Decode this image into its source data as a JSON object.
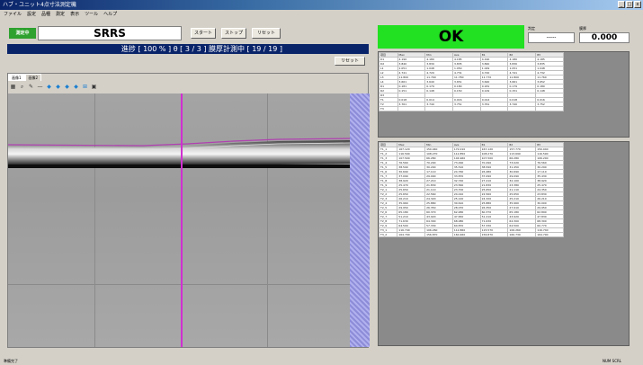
{
  "window": {
    "title": "ハブ・ユニット4点寸法測定機",
    "min": "_",
    "max": "□",
    "close": "x"
  },
  "menu": [
    "ファイル",
    "設定",
    "品種",
    "測定",
    "表示",
    "ツール",
    "ヘルプ"
  ],
  "header": {
    "mode_label": "測定中",
    "product": "SRRS",
    "buttons": [
      "スタート",
      "ストップ",
      "リセット"
    ],
    "status": "進捗 [ 100 % ] θ [ 3 / 3 ] 膜厚計測中 [ 19 / 19 ]",
    "reset_label": "リセット"
  },
  "image_panel": {
    "tabs": [
      "画像1",
      "画像2"
    ]
  },
  "result": {
    "judgement": "OK",
    "left_label": "判定",
    "left_value": "-----",
    "right_label": "膜厚",
    "right_value": "0.000"
  },
  "table1": {
    "headers": [
      "項目",
      "Max",
      "Min",
      "Ave",
      "θ1",
      "θ2",
      "θ3"
    ],
    "rows": [
      [
        "D1",
        "4.190",
        "4.180",
        "4.185",
        "4.190",
        "4.180",
        "4.185"
      ],
      [
        "D2",
        "3.840",
        "3.830",
        "3.835",
        "3.840",
        "3.830",
        "3.835"
      ],
      [
        "L1",
        "1.051",
        "1.048",
        "1.050",
        "1.049",
        "1.051",
        "1.048"
      ],
      [
        "L2",
        "4.741",
        "4.720",
        "4.731",
        "4.720",
        "4.741",
        "4.732"
      ],
      [
        "L3",
        "11.800",
        "11.760",
        "11.780",
        "11.770",
        "11.800",
        "11.760"
      ],
      [
        "L4",
        "3.661",
        "3.640",
        "3.651",
        "3.640",
        "3.661",
        "3.652"
      ],
      [
        "R1",
        "0.181",
        "0.179",
        "0.180",
        "0.181",
        "0.179",
        "0.180"
      ],
      [
        "R2",
        "0.151",
        "0.148",
        "0.150",
        "0.149",
        "0.151",
        "0.148"
      ],
      [
        "R3",
        "",
        "",
        "",
        "",
        "",
        ""
      ],
      [
        "T1",
        "0.018",
        "0.014",
        "0.016",
        "0.014",
        "0.018",
        "0.016"
      ],
      [
        "T2",
        "3.761",
        "3.740",
        "3.751",
        "3.761",
        "3.740",
        "3.752"
      ],
      [
        "T3",
        "",
        "",
        "",
        "",
        "",
        ""
      ]
    ]
  },
  "table2": {
    "headers": [
      "項目",
      "Max",
      "Min",
      "Ave",
      "θ1",
      "θ2",
      "θ3"
    ],
    "rows": [
      [
        "T1_1",
        "167.120",
        "150.040",
        "172.010",
        "167.120",
        "157.770",
        "150.040"
      ],
      [
        "T1_2",
        "116.590",
        "108.270",
        "112.850",
        "108.270",
        "113.690",
        "116.590"
      ],
      [
        "T1_3",
        "107.500",
        "66.280",
        "104.960",
        "107.500",
        "66.280",
        "106.200"
      ],
      [
        "T1_4",
        "76.560",
        "70.290",
        "73.290",
        "70.290",
        "73.020",
        "76.560"
      ],
      [
        "T1_5",
        "38.590",
        "30.290",
        "35.510",
        "38.590",
        "31.450",
        "30.290"
      ],
      [
        "T1_6",
        "30.690",
        "17.110",
        "24.760",
        "26.480",
        "30.690",
        "17.110"
      ],
      [
        "T1_7",
        "37.090",
        "29.090",
        "33.870",
        "37.090",
        "29.090",
        "35.430"
      ],
      [
        "T1_8",
        "38.920",
        "27.210",
        "32.740",
        "27.210",
        "32.100",
        "38.920"
      ],
      [
        "T1_9",
        "25.470",
        "21.830",
        "23.560",
        "21.830",
        "23.380",
        "25.470"
      ],
      [
        "T2_1",
        "25.650",
        "21.110",
        "23.700",
        "25.650",
        "21.110",
        "24.350"
      ],
      [
        "T2_2",
        "25.650",
        "22.560",
        "24.010",
        "22.560",
        "25.650",
        "23.830"
      ],
      [
        "T2_3",
        "26.210",
        "24.320",
        "25.120",
        "24.320",
        "25.210",
        "26.210"
      ],
      [
        "T2_4",
        "35.960",
        "25.880",
        "30.610",
        "25.880",
        "35.960",
        "30.000"
      ],
      [
        "T2_5",
        "29.950",
        "26.350",
        "28.070",
        "26.350",
        "27.910",
        "29.950"
      ],
      [
        "T2_6",
        "65.180",
        "60.370",
        "62.480",
        "60.370",
        "65.180",
        "62.890"
      ],
      [
        "T2_7",
        "51.210",
        "43.920",
        "47.650",
        "51.210",
        "43.920",
        "47.830"
      ],
      [
        "T2_8",
        "71.630",
        "64.300",
        "68.080",
        "71.630",
        "64.300",
        "68.300"
      ],
      [
        "T2_9",
        "64.500",
        "57.330",
        "60.870",
        "57.330",
        "64.500",
        "60.770"
      ],
      [
        "T3_1",
        "116.740",
        "106.260",
        "112.860",
        "115.570",
        "106.260",
        "116.740"
      ],
      [
        "T3_2",
        "164.790",
        "156.870",
        "160.460",
        "156.870",
        "160.730",
        "164.790"
      ]
    ]
  },
  "statusbar": {
    "left": "準備完了",
    "right": "NUM SCRL"
  },
  "colors": {
    "ok": "#22e022",
    "status_bar": "#0a246a",
    "mode_badge": "#2ea12e",
    "cursor": "#d030d0"
  }
}
